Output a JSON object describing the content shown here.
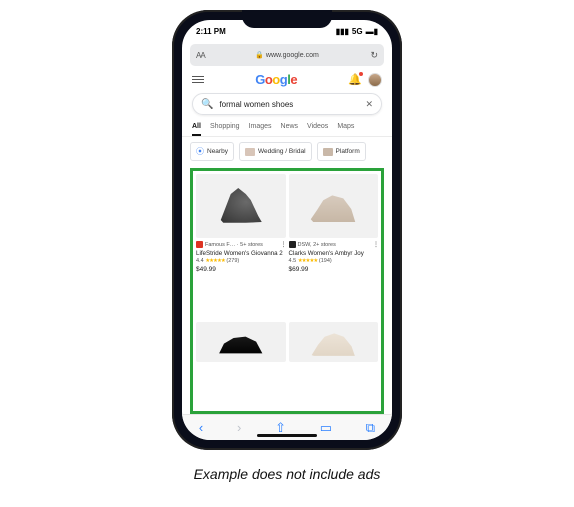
{
  "status": {
    "time": "2:11 PM",
    "network": "5G"
  },
  "url_bar": {
    "text_size": "AA",
    "lock": "🔒",
    "url": "www.google.com",
    "refresh": "↻"
  },
  "logo": {
    "g1": "G",
    "o1": "o",
    "o2": "o",
    "g2": "g",
    "l": "l",
    "e": "e"
  },
  "search": {
    "query": "formal women shoes"
  },
  "tabs": [
    "All",
    "Shopping",
    "Images",
    "News",
    "Videos",
    "Maps"
  ],
  "chips": [
    {
      "icon": "pin",
      "label": "Nearby"
    },
    {
      "icon": "thumb",
      "label": "Wedding / Bridal"
    },
    {
      "icon": "thumb2",
      "label": "Platform"
    }
  ],
  "products": [
    {
      "store_icon_color": "red",
      "store_text": "Famous F… · 5+ stores",
      "title": "LifeStride Women's Giovanna 2",
      "rating": "4.4",
      "reviews": "(279)",
      "price": "$49.99"
    },
    {
      "store_icon_color": "black",
      "store_text": "DSW, 2+ stores",
      "title": "Clarks Women's Ambyr Joy",
      "rating": "4.5",
      "reviews": "(194)",
      "price": "$69.99"
    }
  ],
  "safari": {
    "back": "‹",
    "fwd": "›",
    "share": "⇧",
    "book": "▭",
    "tabs": "⧉"
  },
  "caption": "Example does not include ads"
}
